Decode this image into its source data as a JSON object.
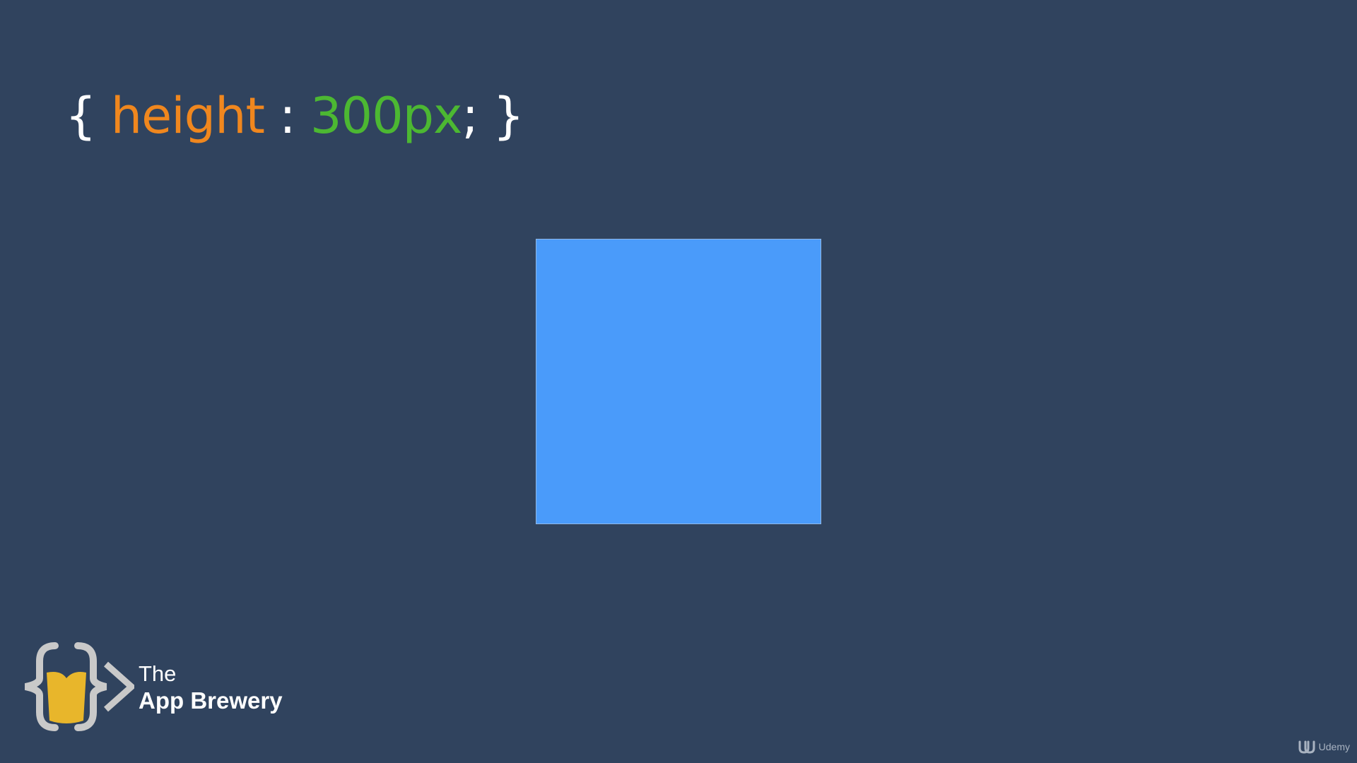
{
  "css_rule": {
    "open_brace": "{ ",
    "property": "height",
    "colon": " : ",
    "value": "300px",
    "semicolon": "; ",
    "close_brace": "}"
  },
  "colors": {
    "background": "#30435e",
    "property": "#f0871e",
    "value": "#4cb832",
    "box_fill": "#4a9bfa",
    "logo_brackets": "#c9c9c9",
    "logo_glass": "#e8b62b"
  },
  "logo": {
    "line1": "The",
    "line2": "App Brewery",
    "icon": "app-brewery-logo-icon"
  },
  "watermark": {
    "label": "Udemy",
    "icon": "udemy-icon"
  }
}
